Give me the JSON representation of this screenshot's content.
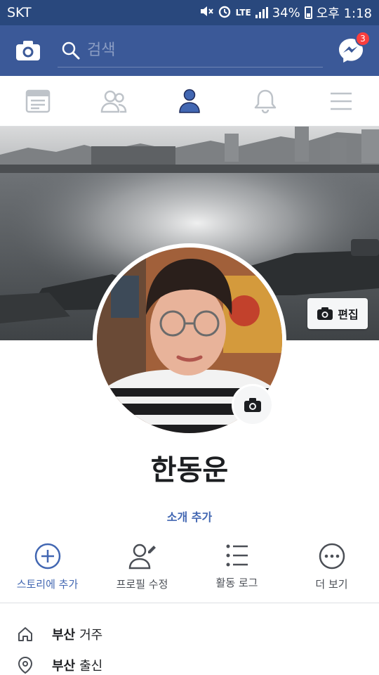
{
  "status_bar": {
    "carrier": "SKT",
    "network": "LTE",
    "battery": "34%",
    "time": "오후 1:18"
  },
  "header": {
    "search_placeholder": "검색",
    "messenger_badge": "3"
  },
  "tabs": [
    {
      "name": "news-feed",
      "active": false
    },
    {
      "name": "friends",
      "active": false
    },
    {
      "name": "profile",
      "active": true
    },
    {
      "name": "notifications",
      "active": false
    },
    {
      "name": "menu",
      "active": false
    }
  ],
  "cover": {
    "edit_label": "편집"
  },
  "profile": {
    "name": "한동운",
    "add_intro": "소개 추가"
  },
  "actions": [
    {
      "label": "스토리에 추가",
      "icon": "plus-circle-icon"
    },
    {
      "label": "프로필 수정",
      "icon": "edit-profile-icon"
    },
    {
      "label": "활동 로그",
      "icon": "list-icon"
    },
    {
      "label": "더 보기",
      "icon": "more-icon"
    }
  ],
  "info": [
    {
      "strong": "부산",
      "text": "거주",
      "icon": "home-icon"
    },
    {
      "strong": "부산",
      "text": "출신",
      "icon": "location-pin-icon"
    }
  ],
  "colors": {
    "brand": "#3b5998",
    "status_bar": "#29487d",
    "accent": "#4267b2",
    "badge": "#fa3e3e"
  }
}
